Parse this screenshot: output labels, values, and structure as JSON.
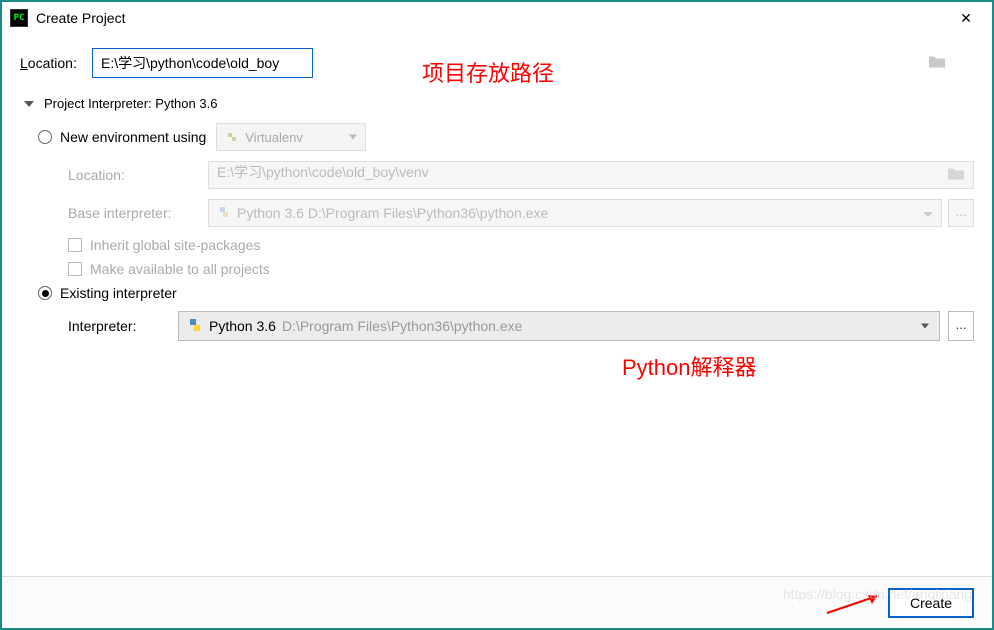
{
  "window": {
    "title": "Create Project"
  },
  "location": {
    "label": "Location:",
    "value": "E:\\学习\\python\\code\\old_boy"
  },
  "section": {
    "title": "Project Interpreter: Python 3.6"
  },
  "newEnv": {
    "radioLabel": "New environment using",
    "tool": "Virtualenv",
    "locLabel": "Location:",
    "locValue": "E:\\学习\\python\\code\\old_boy\\venv",
    "baseLabel": "Base interpreter:",
    "baseValue": "Python 3.6 D:\\Program Files\\Python36\\python.exe",
    "inheritLabel": "Inherit global site-packages",
    "makeAvailLabel": "Make available to all projects"
  },
  "existing": {
    "radioLabel": "Existing interpreter",
    "interpLabel": "Interpreter:",
    "interpName": "Python 3.6",
    "interpPath": "D:\\Program Files\\Python36\\python.exe"
  },
  "buttons": {
    "create": "Create"
  },
  "annotations": {
    "pathNote": "项目存放路径",
    "interpNote": "Python解释器"
  },
  "watermark": "https://blog.csdn.net/anqixiang"
}
